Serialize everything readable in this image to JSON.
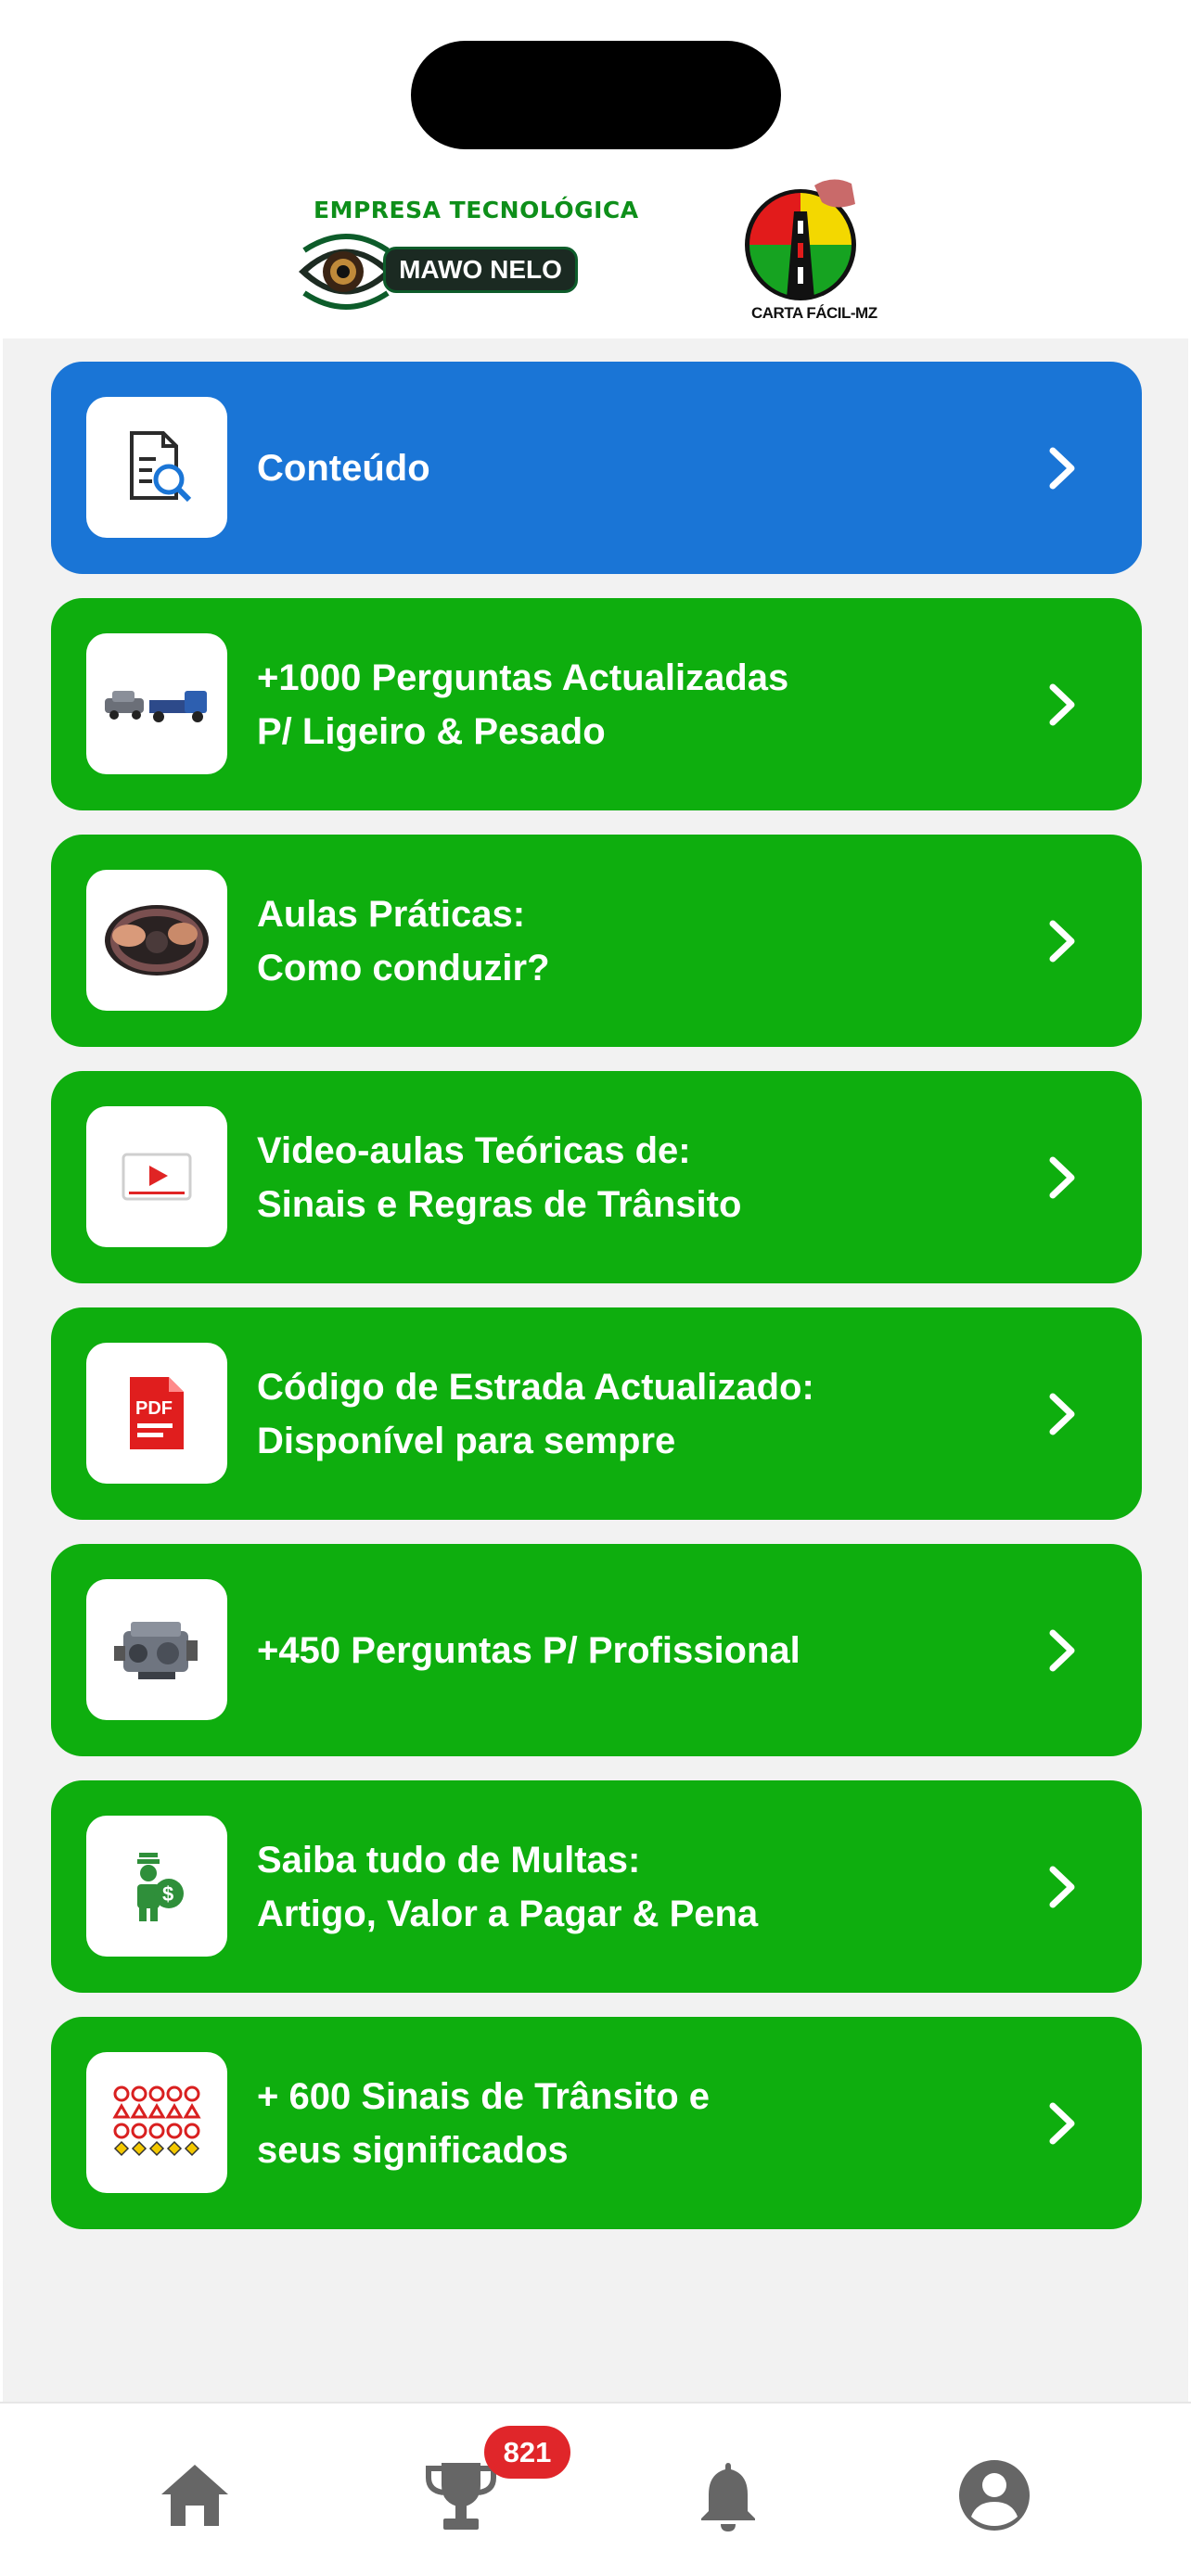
{
  "header": {
    "brand_left_tagline": "EMPRESA TECNOLÓGICA",
    "brand_left_name": "MAWO NELO",
    "brand_right_name": "CARTA FÁCIL-MZ"
  },
  "menu": [
    {
      "line1": "Conteúdo",
      "line2": "",
      "icon": "document-search-icon",
      "color": "#1a75d6"
    },
    {
      "line1": "+1000 Perguntas Actualizadas",
      "line2": "P/ Ligeiro & Pesado",
      "icon": "vehicles-icon",
      "color": "#0eae0e"
    },
    {
      "line1": "Aulas Práticas:",
      "line2": "Como conduzir?",
      "icon": "steering-wheel-icon",
      "color": "#0eae0e"
    },
    {
      "line1": "Video-aulas Teóricas de:",
      "line2": "Sinais e Regras de Trânsito",
      "icon": "video-player-icon",
      "color": "#0eae0e"
    },
    {
      "line1": "Código de Estrada Actualizado:",
      "line2": "Disponível para sempre",
      "icon": "pdf-file-icon",
      "color": "#0eae0e"
    },
    {
      "line1": "+450 Perguntas P/ Profissional",
      "line2": "",
      "icon": "engine-icon",
      "color": "#0eae0e"
    },
    {
      "line1": "Saiba tudo de Multas:",
      "line2": "Artigo, Valor a Pagar & Pena",
      "icon": "fine-money-icon",
      "color": "#0eae0e"
    },
    {
      "line1": "+ 600 Sinais de Trânsito e",
      "line2": "seus significados",
      "icon": "traffic-signs-icon",
      "color": "#0eae0e"
    }
  ],
  "bottom_nav": {
    "items": [
      {
        "name": "home",
        "icon": "home-icon"
      },
      {
        "name": "trophy",
        "icon": "trophy-icon"
      },
      {
        "name": "notifications",
        "icon": "bell-icon"
      },
      {
        "name": "profile",
        "icon": "account-circle-icon"
      }
    ],
    "trophy_badge": "821"
  }
}
